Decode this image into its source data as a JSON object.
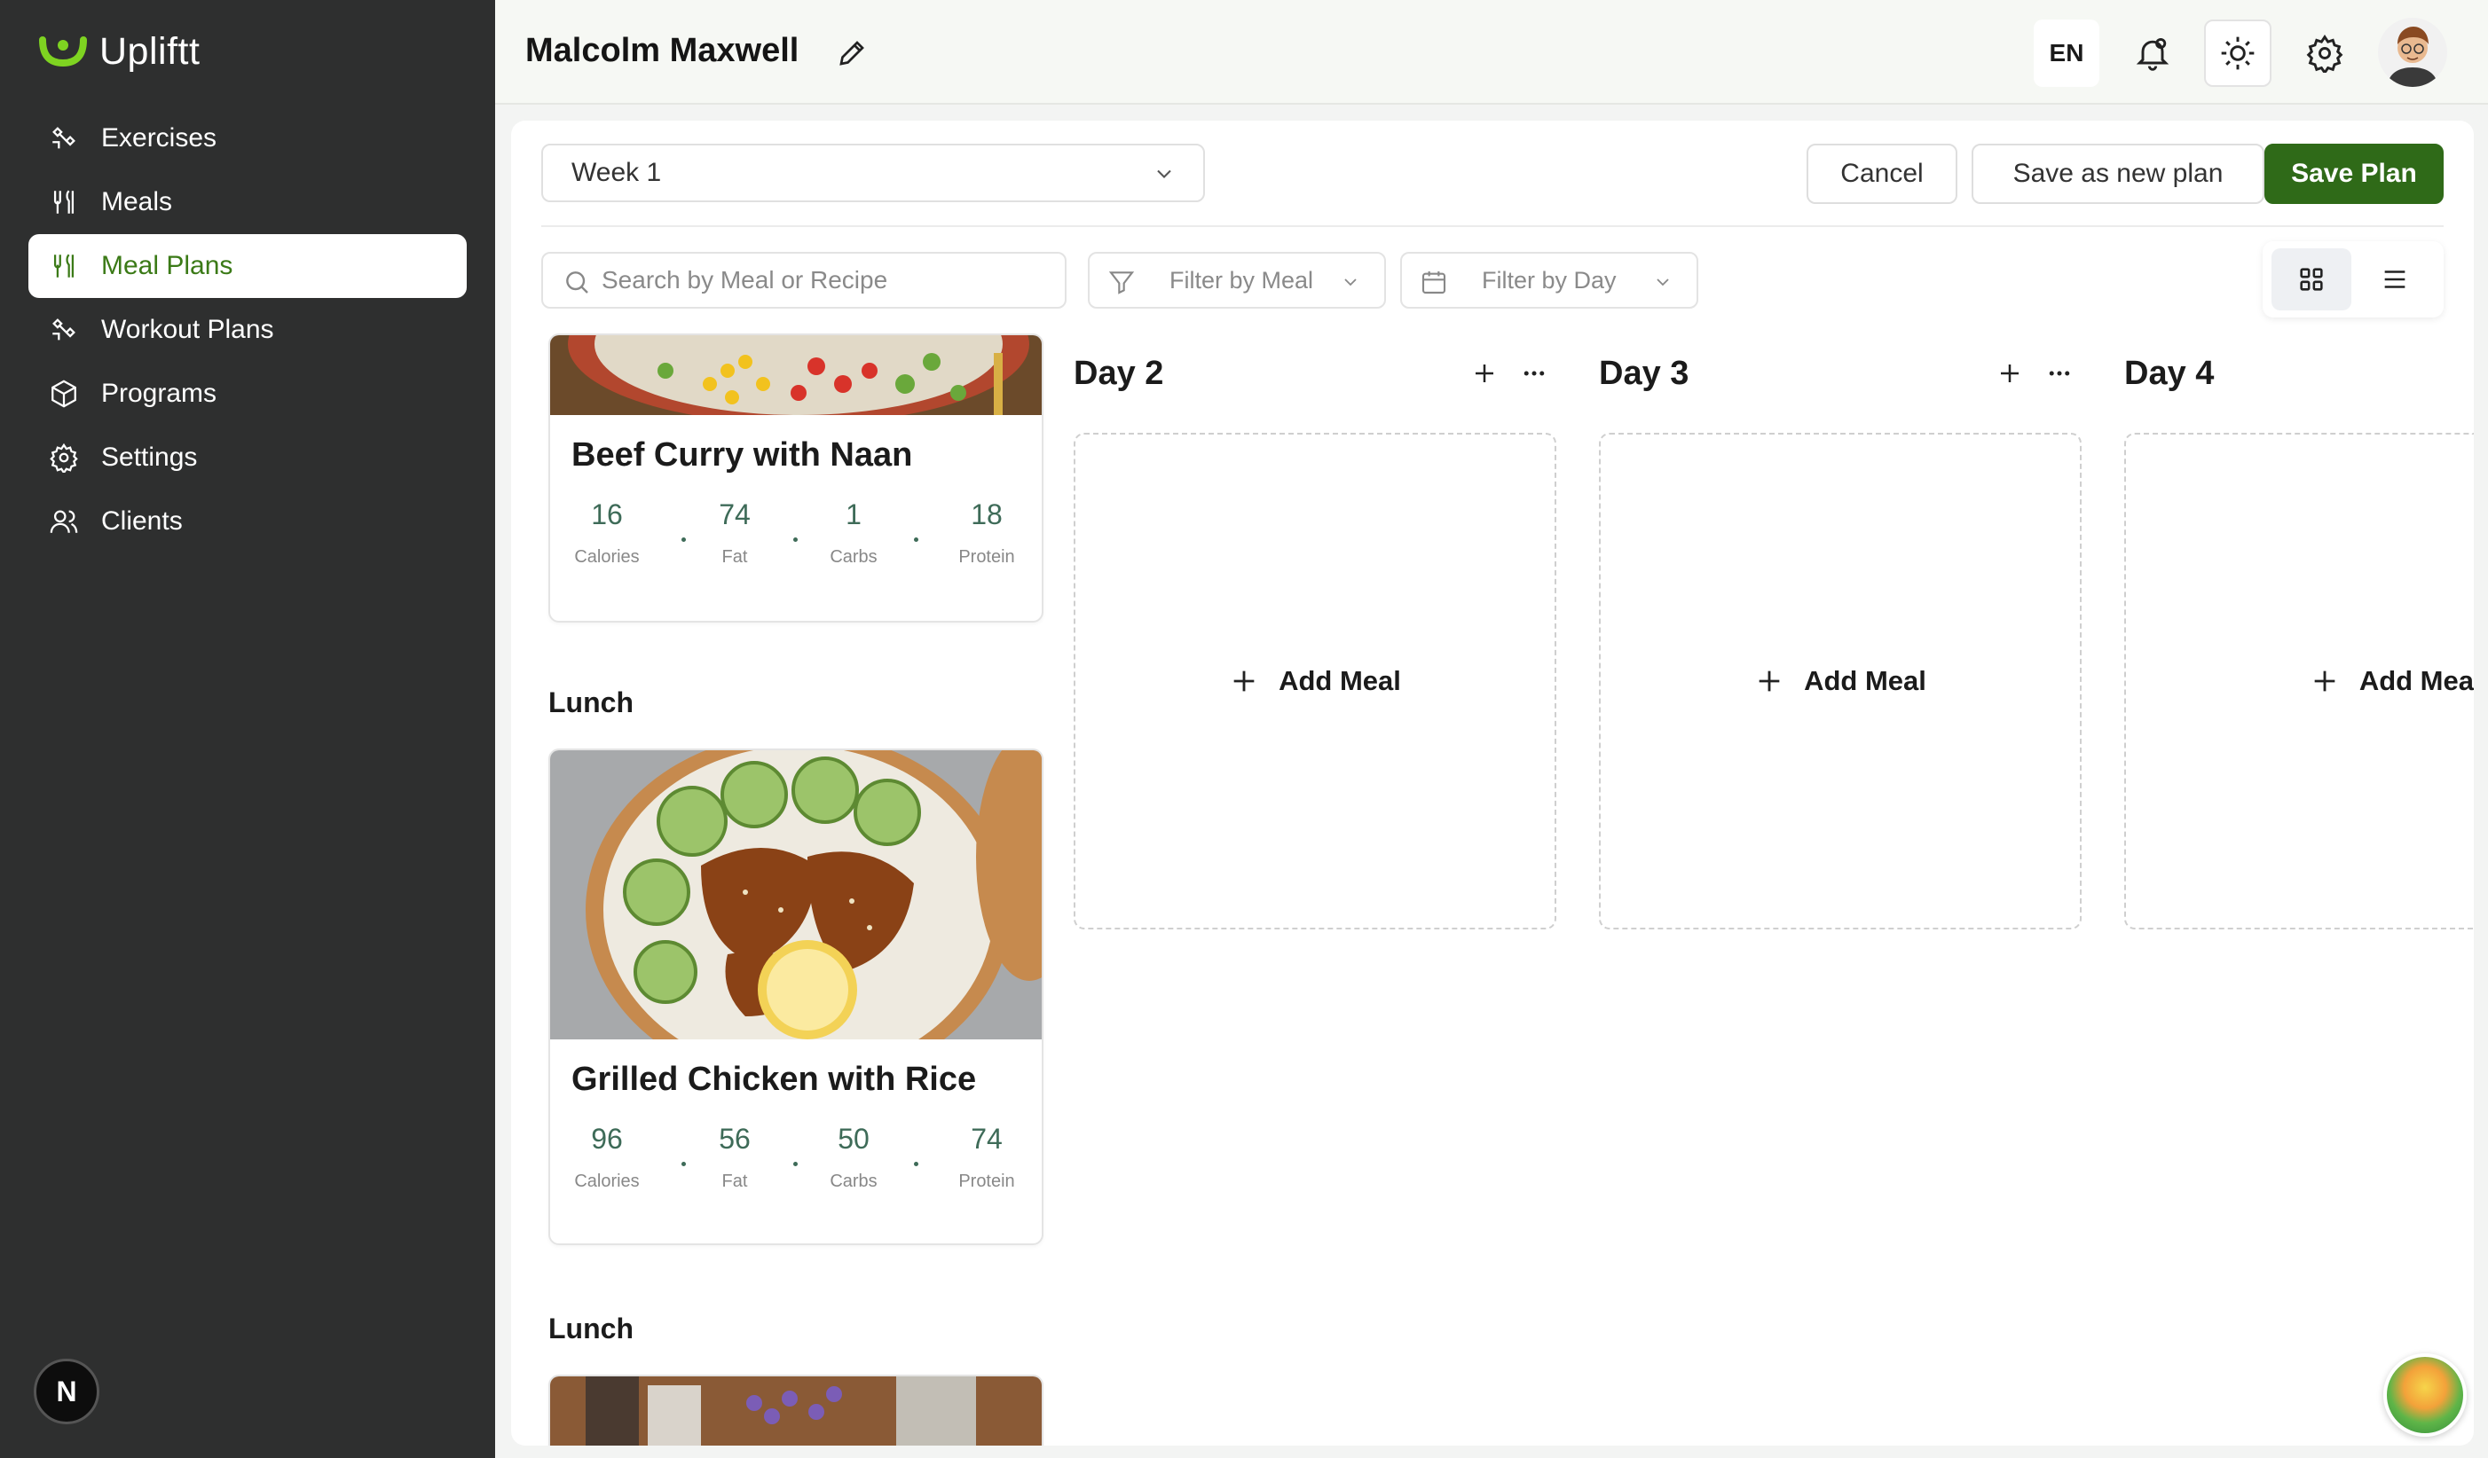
{
  "app": {
    "name": "Upliftt"
  },
  "sidebar": {
    "items": [
      {
        "label": "Exercises",
        "icon": "exercise-icon"
      },
      {
        "label": "Meals",
        "icon": "fork-knife-icon"
      },
      {
        "label": "Meal Plans",
        "icon": "fork-knife-icon",
        "active": true
      },
      {
        "label": "Workout Plans",
        "icon": "exercise-icon"
      },
      {
        "label": "Programs",
        "icon": "cube-icon"
      },
      {
        "label": "Settings",
        "icon": "gear-icon"
      },
      {
        "label": "Clients",
        "icon": "users-icon"
      }
    ],
    "bottom_badge": "N"
  },
  "header": {
    "client_name": "Malcolm Maxwell",
    "language": "EN"
  },
  "toolbar": {
    "week_value": "Week 1",
    "cancel_label": "Cancel",
    "save_new_label": "Save as new plan",
    "save_label": "Save Plan"
  },
  "filters": {
    "search_placeholder": "Search by Meal or Recipe",
    "meal_filter": "Filter by Meal",
    "day_filter": "Filter by Day"
  },
  "meals": [
    {
      "name": "Beef Curry with Naan",
      "macros": [
        {
          "value": "16",
          "label": "Calories"
        },
        {
          "value": "74",
          "label": "Fat"
        },
        {
          "value": "1",
          "label": "Carbs"
        },
        {
          "value": "18",
          "label": "Protein"
        }
      ]
    },
    {
      "section": "Lunch",
      "name": "Grilled Chicken with Rice",
      "macros": [
        {
          "value": "96",
          "label": "Calories"
        },
        {
          "value": "56",
          "label": "Fat"
        },
        {
          "value": "50",
          "label": "Carbs"
        },
        {
          "value": "74",
          "label": "Protein"
        }
      ]
    },
    {
      "section": "Lunch"
    }
  ],
  "days": [
    {
      "title": "Day 2",
      "add_label": "Add Meal"
    },
    {
      "title": "Day 3",
      "add_label": "Add Meal"
    },
    {
      "title": "Day 4",
      "add_label": "Add Mea"
    }
  ],
  "colors": {
    "sidebar_bg": "#2e2f2f",
    "accent_green": "#2f6a18",
    "logo_green": "#7ed321",
    "macro_value": "#3e6b58"
  }
}
